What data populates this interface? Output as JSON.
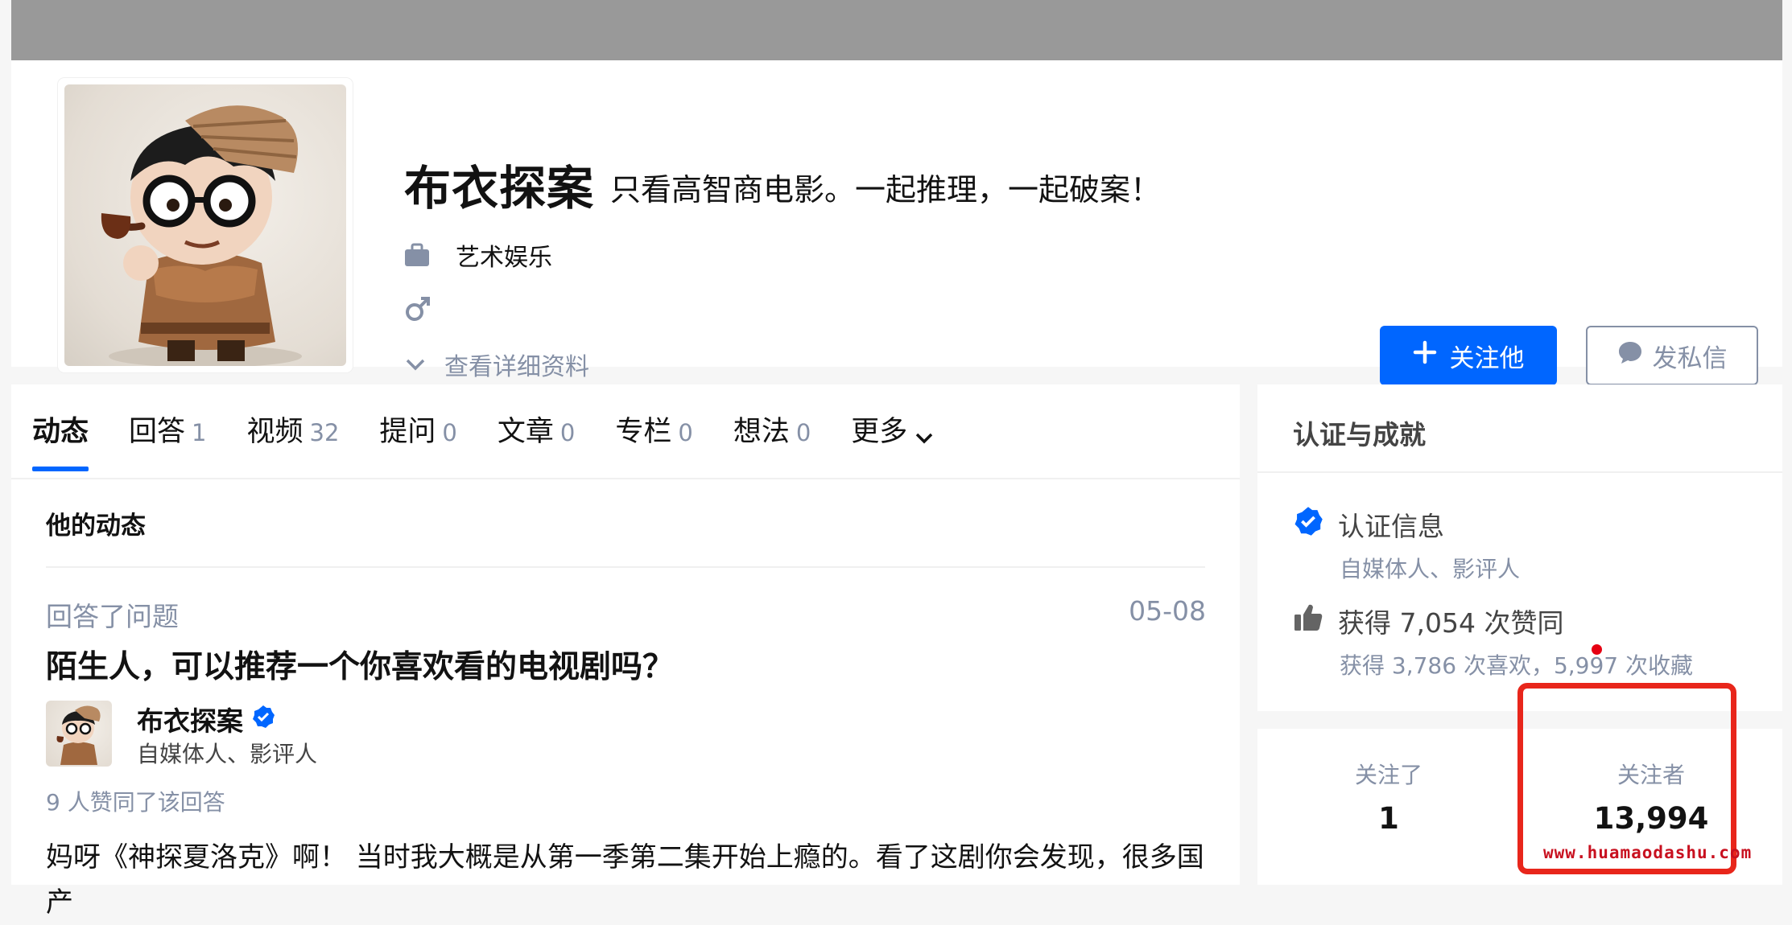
{
  "profile": {
    "name": "布衣探案",
    "headline": "只看高智商电影。一起推理，一起破案！",
    "industry": "艺术娱乐",
    "gender_icon": "male-icon",
    "more_info": "查看详细资料",
    "follow_button": "关注他",
    "message_button": "发私信"
  },
  "tabs": [
    {
      "label": "动态",
      "count": ""
    },
    {
      "label": "回答",
      "count": "1"
    },
    {
      "label": "视频",
      "count": "32"
    },
    {
      "label": "提问",
      "count": "0"
    },
    {
      "label": "文章",
      "count": "0"
    },
    {
      "label": "专栏",
      "count": "0"
    },
    {
      "label": "想法",
      "count": "0"
    },
    {
      "label": "更多",
      "count": ""
    }
  ],
  "feed": {
    "section_title": "他的动态",
    "meta": "回答了问题",
    "date": "05-08",
    "question": "陌生人，可以推荐一个你喜欢看的电视剧吗？",
    "author_name": "布衣探案",
    "author_bio": "自媒体人、影评人",
    "voters": "9 人赞同了该回答",
    "excerpt": "妈呀《神探夏洛克》啊！ 当时我大概是从第一季第二集开始上瘾的。看了这剧你会发现，很多国产"
  },
  "achievements": {
    "title": "认证与成就",
    "cert_label": "认证信息",
    "cert_detail": "自媒体人、影评人",
    "likes": "获得 7,054 次赞同",
    "likes_detail": "获得 3,786 次喜欢，5,997 次收藏"
  },
  "follow_stats": {
    "following_label": "关注了",
    "following_value": "1",
    "followers_label": "关注者",
    "followers_value": "13,994"
  },
  "watermark": "www.huamaodashu.com",
  "colors": {
    "accent": "#0066ff",
    "banner": "#999999",
    "highlight": "#e8261b"
  }
}
